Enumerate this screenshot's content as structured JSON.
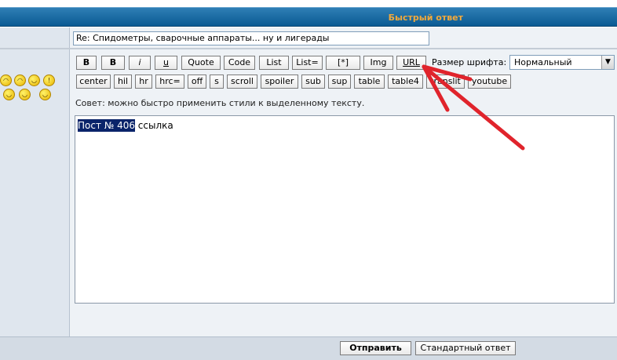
{
  "header": {
    "title": "Быстрый ответ"
  },
  "subject": {
    "value": "Re: Спидометры, сварочные аппараты... ну и лигерады"
  },
  "smileys": [
    "laugh-smiley-icon",
    "cool-smiley-icon",
    "wink-smiley-icon",
    "exclaim-smiley-icon",
    "clap-smiley-icon",
    "thinking-smiley-icon",
    "thumbs-smiley-icon"
  ],
  "toolbar": {
    "row1": [
      "B",
      "B",
      "i",
      "u",
      "Quote",
      "Code",
      "List",
      "List=",
      "[*]",
      "Img",
      "URL"
    ],
    "row2": [
      "center",
      "hil",
      "hr",
      "hrc=",
      "off",
      "s",
      "scroll",
      "spoiler",
      "sub",
      "sup",
      "table",
      "table4",
      "translit",
      "youtube"
    ]
  },
  "font_size": {
    "label": "Размер шрифта:",
    "value": "Нормальный"
  },
  "hint": "Совет: можно быстро применить стили к выделенному тексту.",
  "editor": {
    "selected_text": "Пост № 406",
    "rest_text": " ссылка"
  },
  "actions": {
    "submit": "Отправить",
    "standard": "Стандартный ответ"
  },
  "colors": {
    "header": "#0a5a93",
    "header_title": "#f2a93b",
    "arrow": "#e0242c",
    "selection": "#0a246a"
  }
}
